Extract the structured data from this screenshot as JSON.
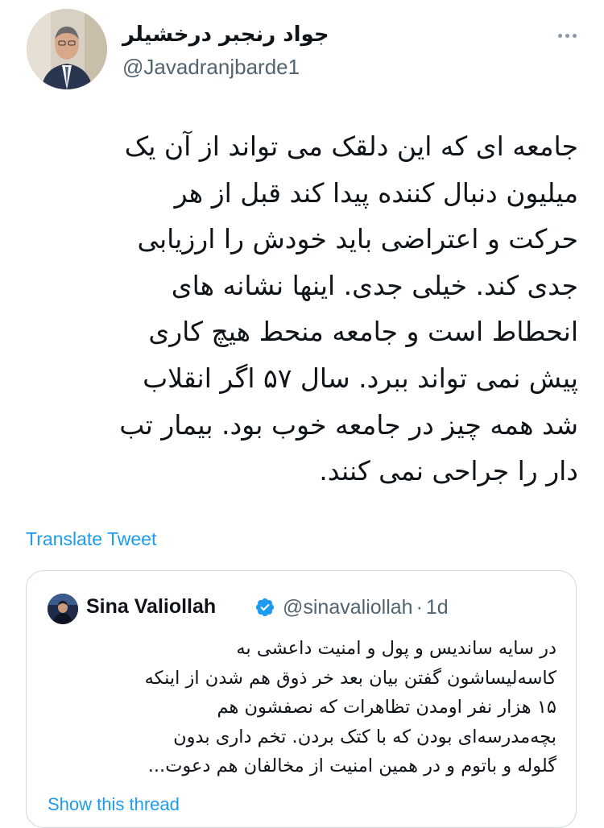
{
  "author": {
    "display_name": "جواد رنجبر درخشیلر",
    "handle": "@Javadranjbarde1"
  },
  "tweet": {
    "text": "جامعه ای که این دلقک می تواند از آن یک\nمیلیون دنبال کننده پیدا کند قبل از هر\nحرکت و اعتراضی باید خودش را ارزیابی\nجدی کند. خیلی جدی. اینها نشانه های\nانحطاط است و جامعه منحط هیچ کاری\nپیش نمی تواند ببرد. سال ۵۷ اگر انقلاب\nشد همه چیز در جامعه خوب بود. بیمار تب\nدار را جراحی نمی کنند.",
    "translate_label": "Translate Tweet"
  },
  "quote": {
    "name": "Sina Valiollah",
    "handle": "@sinavaliollah",
    "separator": "·",
    "time": "1d",
    "text": "در سایه ساندیس و پول و امنیت داعشی به\nکاسه‌لیساشون گفتن بیان بعد خر ذوق هم شدن از اینکه\n۱۵ هزار نفر اومدن تظاهرات که نصفشون هم\nبچه‌مدرسه‌ای بودن که با کتک بردن. تخم داری بدون\nگلوله و باتوم و در همین امنیت از مخالفان هم دعوت...",
    "translate_label": "Show this thread"
  },
  "colors": {
    "link": "#1d9bf0",
    "secondary_text": "#536471",
    "border": "#cfd9de",
    "verified": "#1d9bf0"
  },
  "icons": {
    "more": "more-dots-icon",
    "verified": "verified-badge-icon"
  }
}
